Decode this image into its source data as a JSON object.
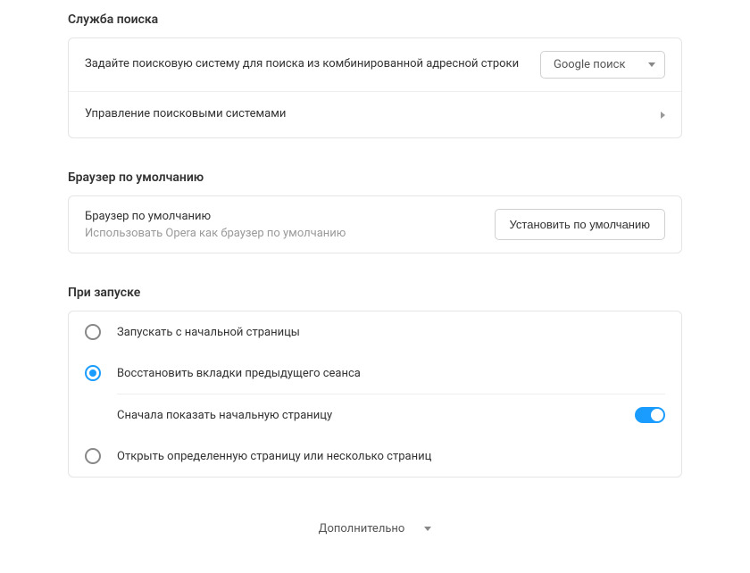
{
  "search": {
    "title": "Служба поиска",
    "row1_label": "Задайте поисковую систему для поиска из комбинированной адресной строки",
    "engine_selected": "Google поиск",
    "row2_label": "Управление поисковыми системами"
  },
  "default_browser": {
    "title": "Браузер по умолчанию",
    "row_label": "Браузер по умолчанию",
    "row_sub": "Использовать Opera как браузер по умолчанию",
    "button": "Установить по умолчанию"
  },
  "on_startup": {
    "title": "При запуске",
    "opt1": "Запускать с начальной страницы",
    "opt2": "Восстановить вкладки предыдущего сеанса",
    "opt2_sub": "Сначала показать начальную страницу",
    "opt3": "Открыть определенную страницу или несколько страниц"
  },
  "footer": {
    "label": "Дополнительно"
  }
}
